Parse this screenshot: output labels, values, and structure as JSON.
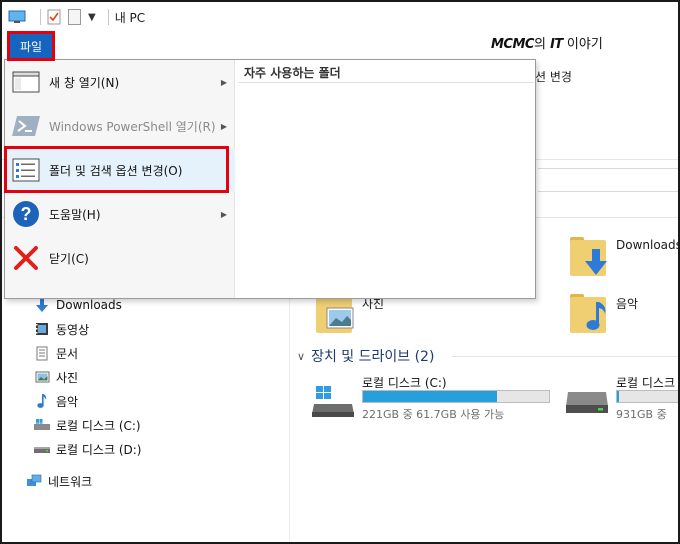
{
  "window": {
    "title": "내 PC"
  },
  "watermark": {
    "brand": "MCMC",
    "mid": "의 ",
    "it": "IT",
    "tail": " 이야기"
  },
  "file_tab": {
    "label": "파일"
  },
  "ribbon": {
    "partial_text": "션 변경"
  },
  "file_menu": {
    "items": [
      {
        "label": "새 창 열기(N)",
        "has_submenu": true,
        "enabled": true
      },
      {
        "label": "Windows PowerShell 열기(R)",
        "has_submenu": true,
        "enabled": false
      },
      {
        "label": "폴더 및 검색 옵션 변경(O)",
        "has_submenu": false,
        "enabled": true,
        "highlighted": true
      },
      {
        "label": "도움말(H)",
        "has_submenu": true,
        "enabled": true
      },
      {
        "label": "닫기(C)",
        "has_submenu": false,
        "enabled": true
      }
    ],
    "frequent_folders_title": "자주 사용하는 폴더"
  },
  "nav_pane": {
    "items": [
      {
        "label": "Downloads",
        "icon": "download-arrow-icon"
      },
      {
        "label": "동영상",
        "icon": "film-icon"
      },
      {
        "label": "문서",
        "icon": "document-icon"
      },
      {
        "label": "사진",
        "icon": "picture-icon"
      },
      {
        "label": "음악",
        "icon": "music-note-icon"
      },
      {
        "label": "로컬 디스크 (C:)",
        "icon": "drive-windows-icon"
      },
      {
        "label": "로컬 디스크 (D:)",
        "icon": "drive-icon"
      }
    ],
    "network": {
      "label": "네트워크",
      "icon": "network-icon"
    }
  },
  "content": {
    "folders": [
      {
        "label": "Downloads",
        "icon": "downloads-folder-icon"
      },
      {
        "label": "사진",
        "icon": "pictures-folder-icon"
      },
      {
        "label": "음악",
        "icon": "music-folder-icon"
      }
    ],
    "devices_section": {
      "label": "장치 및 드라이브 (2)"
    },
    "drives": [
      {
        "name": "로컬 디스크 (C:)",
        "free_text": "221GB 중 61.7GB 사용 가능",
        "used_fraction": 0.72
      },
      {
        "name": "로컬 디스크",
        "free_text": "931GB 중",
        "used_fraction": 0.03
      }
    ]
  },
  "colors": {
    "file_tab_bg": "#1565c0",
    "highlight_border": "#e3000f",
    "drive_fill": "#26a0da",
    "menu_highlight": "#e5f1fb"
  }
}
